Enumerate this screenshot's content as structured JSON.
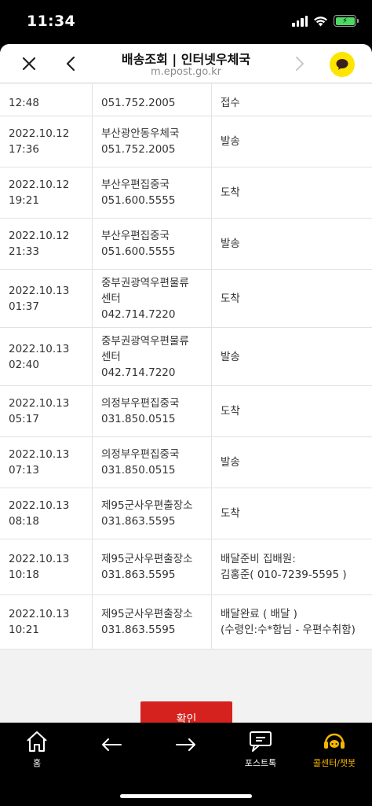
{
  "status_bar": {
    "time": "11:34"
  },
  "header": {
    "title": "배송조회 | 인터넷우체국",
    "url": "m.epost.go.kr"
  },
  "tracking_rows": [
    {
      "time_lines": [
        "",
        "12:48"
      ],
      "office_lines": [
        "",
        "051.752.2005"
      ],
      "status_lines": [
        "접수"
      ]
    },
    {
      "time_lines": [
        "2022.10.12",
        "17:36"
      ],
      "office_lines": [
        "부산광안동우체국",
        "051.752.2005"
      ],
      "status_lines": [
        "발송"
      ]
    },
    {
      "time_lines": [
        "2022.10.12",
        "19:21"
      ],
      "office_lines": [
        "부산우편집중국",
        "051.600.5555"
      ],
      "status_lines": [
        "도착"
      ]
    },
    {
      "time_lines": [
        "2022.10.12",
        "21:33"
      ],
      "office_lines": [
        "부산우편집중국",
        "051.600.5555"
      ],
      "status_lines": [
        "발송"
      ]
    },
    {
      "time_lines": [
        "2022.10.13",
        "01:37"
      ],
      "office_lines": [
        "중부권광역우편물류",
        "센터",
        "042.714.7220"
      ],
      "status_lines": [
        "도착"
      ]
    },
    {
      "time_lines": [
        "2022.10.13",
        "02:40"
      ],
      "office_lines": [
        "중부권광역우편물류",
        "센터",
        "042.714.7220"
      ],
      "status_lines": [
        "발송"
      ]
    },
    {
      "time_lines": [
        "2022.10.13",
        "05:17"
      ],
      "office_lines": [
        "의정부우편집중국",
        "031.850.0515"
      ],
      "status_lines": [
        "도착"
      ]
    },
    {
      "time_lines": [
        "2022.10.13",
        "07:13"
      ],
      "office_lines": [
        "의정부우편집중국",
        "031.850.0515"
      ],
      "status_lines": [
        "발송"
      ]
    },
    {
      "time_lines": [
        "2022.10.13",
        "08:18"
      ],
      "office_lines": [
        "제95군사우편출장소",
        "031.863.5595"
      ],
      "status_lines": [
        "도착"
      ]
    },
    {
      "time_lines": [
        "2022.10.13",
        "10:18"
      ],
      "office_lines": [
        "제95군사우편출장소",
        "031.863.5595"
      ],
      "status_lines": [
        "배달준비 집배원:",
        "김홍준( 010-7239-5595 )"
      ]
    },
    {
      "time_lines": [
        "2022.10.13",
        "10:21"
      ],
      "office_lines": [
        "제95군사우편출장소",
        "031.863.5595"
      ],
      "status_lines": [
        "배달완료 ( 배달 )",
        "(수령인:수*함님 - 우편수취함)"
      ]
    }
  ],
  "confirm_label": "확인",
  "toolbar": {
    "home_label": "홈",
    "posttalk_label": "포스트톡",
    "callcenter_label": "콜센터/챗봇",
    "accent_color": "#f7b500"
  }
}
